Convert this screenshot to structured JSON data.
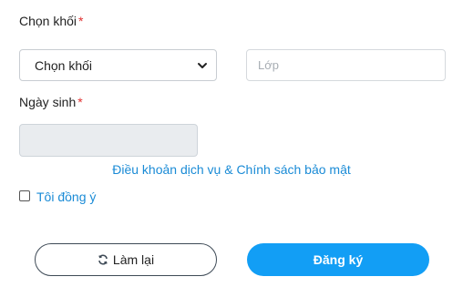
{
  "grade": {
    "label": "Chọn khối",
    "required_mark": "*",
    "select_value": "Chọn khối"
  },
  "class_field": {
    "placeholder": "Lớp"
  },
  "birthdate": {
    "label": "Ngày sinh",
    "required_mark": "*"
  },
  "terms_link": "Điều khoản dịch vụ & Chính sách bảo mật",
  "agree": {
    "label": "Tôi đồng ý",
    "checked": false
  },
  "buttons": {
    "reset_label": "Làm lại",
    "submit_label": "Đăng ký"
  },
  "colors": {
    "accent": "#129ef5",
    "link": "#1a8bd6",
    "required": "#e03131"
  },
  "icons": {
    "select": "chevron-down-icon",
    "reset": "refresh-icon"
  }
}
